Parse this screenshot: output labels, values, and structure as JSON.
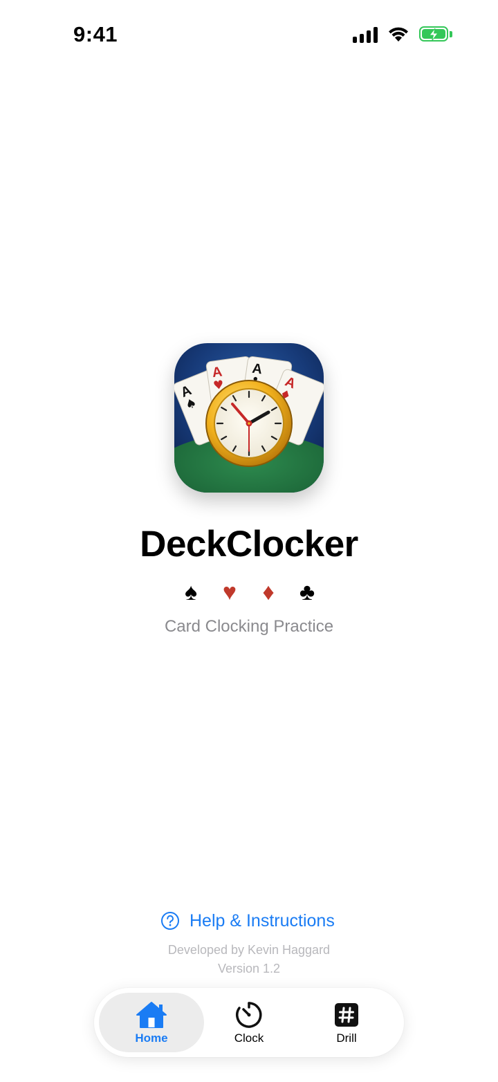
{
  "status_bar": {
    "time": "9:41",
    "icons": [
      "cellular-signal-icon",
      "wifi-icon",
      "battery-charging-icon"
    ]
  },
  "app": {
    "name": "DeckClocker",
    "tagline": "Card Clocking Practice",
    "icon": "deckclocker-app-icon",
    "suits": [
      {
        "symbol": "♠",
        "color": "#000000"
      },
      {
        "symbol": "♥",
        "color": "#c0392b"
      },
      {
        "symbol": "♦",
        "color": "#c0392b"
      },
      {
        "symbol": "♣",
        "color": "#000000"
      }
    ]
  },
  "help": {
    "label": "Help & Instructions",
    "icon": "question-circle-icon"
  },
  "footer": {
    "developer": "Developed by Kevin Haggard",
    "version": "Version 1.2"
  },
  "tab_bar": {
    "tabs": [
      {
        "label": "Home",
        "icon": "house-icon",
        "active": true
      },
      {
        "label": "Clock",
        "icon": "timer-icon",
        "active": false
      },
      {
        "label": "Drill",
        "icon": "number-sign-icon",
        "active": false
      }
    ]
  },
  "colors": {
    "accent": "#1a7cf4",
    "battery": "#34c759",
    "muted_text": "#8a8a8e"
  }
}
